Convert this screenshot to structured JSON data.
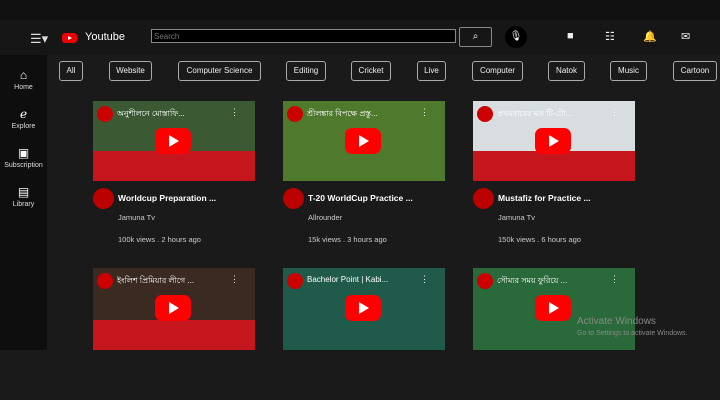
{
  "header": {
    "brand": "Youtube",
    "search_placeholder": "Search",
    "menu_icon": "hamburger-icon",
    "search_icon": "magnifier-icon",
    "mic_icon": "microphone-icon"
  },
  "sidebar": {
    "items": [
      {
        "label": "Home",
        "icon": "home-icon"
      },
      {
        "label": "Explore",
        "icon": "explore-icon"
      },
      {
        "label": "Subscription",
        "icon": "subscription-icon"
      },
      {
        "label": "Library",
        "icon": "library-icon"
      }
    ]
  },
  "chips": [
    "All",
    "Website",
    "Computer Science",
    "Editing",
    "Cricket",
    "Live",
    "Computer",
    "Natok",
    "Music",
    "Cartoon"
  ],
  "videos": [
    {
      "thumb_title": "অনুশীলনে মোস্তাফি...",
      "title": "Worldcup Preparation ...",
      "channel": "Jamuna Tv",
      "meta": "100k views . 2 hours ago",
      "bg": "#3b5a33"
    },
    {
      "thumb_title": "শ্রীলঙ্কার বিপক্ষে প্রস্তু...",
      "title": "T-20 WorldCup Practice ...",
      "channel": "Allrounder",
      "meta": "15k views . 3 hours ago",
      "bg": "#4f7a2e"
    },
    {
      "thumb_title": "প্রথমবারের মত টি-টো...",
      "title": "Mustafiz for Practice ...",
      "channel": "Jamuna Tv",
      "meta": "150k views . 6 hours ago",
      "bg": "#d8dde0"
    },
    {
      "thumb_title": "ইংলিশ প্রিমিয়ার লীগে ...",
      "bg": "#3a2a22"
    },
    {
      "thumb_title": "Bachelor Point | Kabi...",
      "bg": "#1f5a4a"
    },
    {
      "thumb_title": "সৌম্যর সময় ফুরিয়ে ...",
      "bg": "#2a6a3a"
    }
  ],
  "watermark": {
    "line1": "Activate Windows",
    "line2": "Go to Settings to activate Windows."
  }
}
